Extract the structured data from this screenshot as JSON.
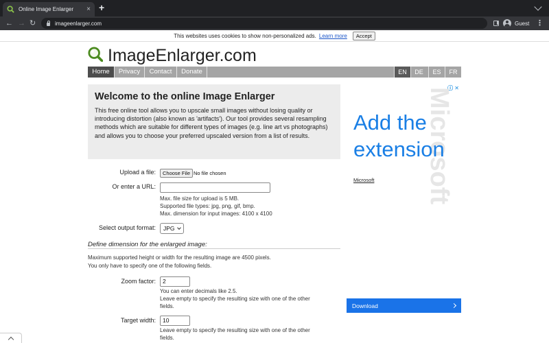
{
  "browser": {
    "tab_title": "Online Image Enlarger",
    "new_tab": "+",
    "close_tab": "×",
    "url": "imageenlarger.com",
    "back": "←",
    "forward": "→",
    "reload": "↻",
    "profile_label": "Guest",
    "menu": "⋮"
  },
  "cookie_bar": {
    "text": "This websites uses cookies to show non-personalized ads.",
    "link": "Learn more",
    "accept": "Accept"
  },
  "site": {
    "title": "ImageEnlarger.com",
    "accent_color": "#4a8a1e"
  },
  "nav": {
    "items": [
      "Home",
      "Privacy",
      "Contact",
      "Donate"
    ],
    "active": "Home",
    "languages": [
      "EN",
      "DE",
      "ES",
      "FR"
    ],
    "active_language": "EN"
  },
  "welcome": {
    "title": "Welcome to the online Image Enlarger",
    "text": "This free online tool allows you to upscale small images without losing quality or introducing distortion (also known as 'artifacts'). Our tool provides several resampling methods which are suitable for different types of images (e.g. line art vs photographs) and allows you to choose your preferred upscaled version from a list of results."
  },
  "form": {
    "upload_label": "Upload a file:",
    "choose_file": "Choose File",
    "no_file": "No file chosen",
    "url_label": "Or enter a URL:",
    "url_value": "",
    "hint_size": "Max. file size for upload is 5 MB.",
    "hint_types": "Supported file types: jpg, png, gif, bmp.",
    "hint_dim": "Max. dimension for input images: 4100 x 4100",
    "format_label": "Select output format:",
    "format_value": "JPG",
    "dimension_heading": "Define dimension for the enlarged image:",
    "max_note": "Maximum supported height or width for the resulting image are 4500 pixels.",
    "one_field_note": "You only have to specify one of the following fields.",
    "zoom_label": "Zoom factor:",
    "zoom_value": "2",
    "zoom_hint1": "You can enter decimals like 2.5.",
    "zoom_hint2": "Leave empty to specify the resulting size with one of the other",
    "zoom_hint3": "fields.",
    "width_label": "Target width:",
    "width_value": "10",
    "width_hint1": "Leave empty to specify the resulting size with one of the other",
    "width_hint2": "fields."
  },
  "ad": {
    "choices": "ⓘ ✕",
    "watermark": "Microsoft",
    "headline_line1": "Add the",
    "headline_line2": "extension",
    "brand": "Microsoft",
    "cta": "Download",
    "color": "#1a73e8"
  }
}
